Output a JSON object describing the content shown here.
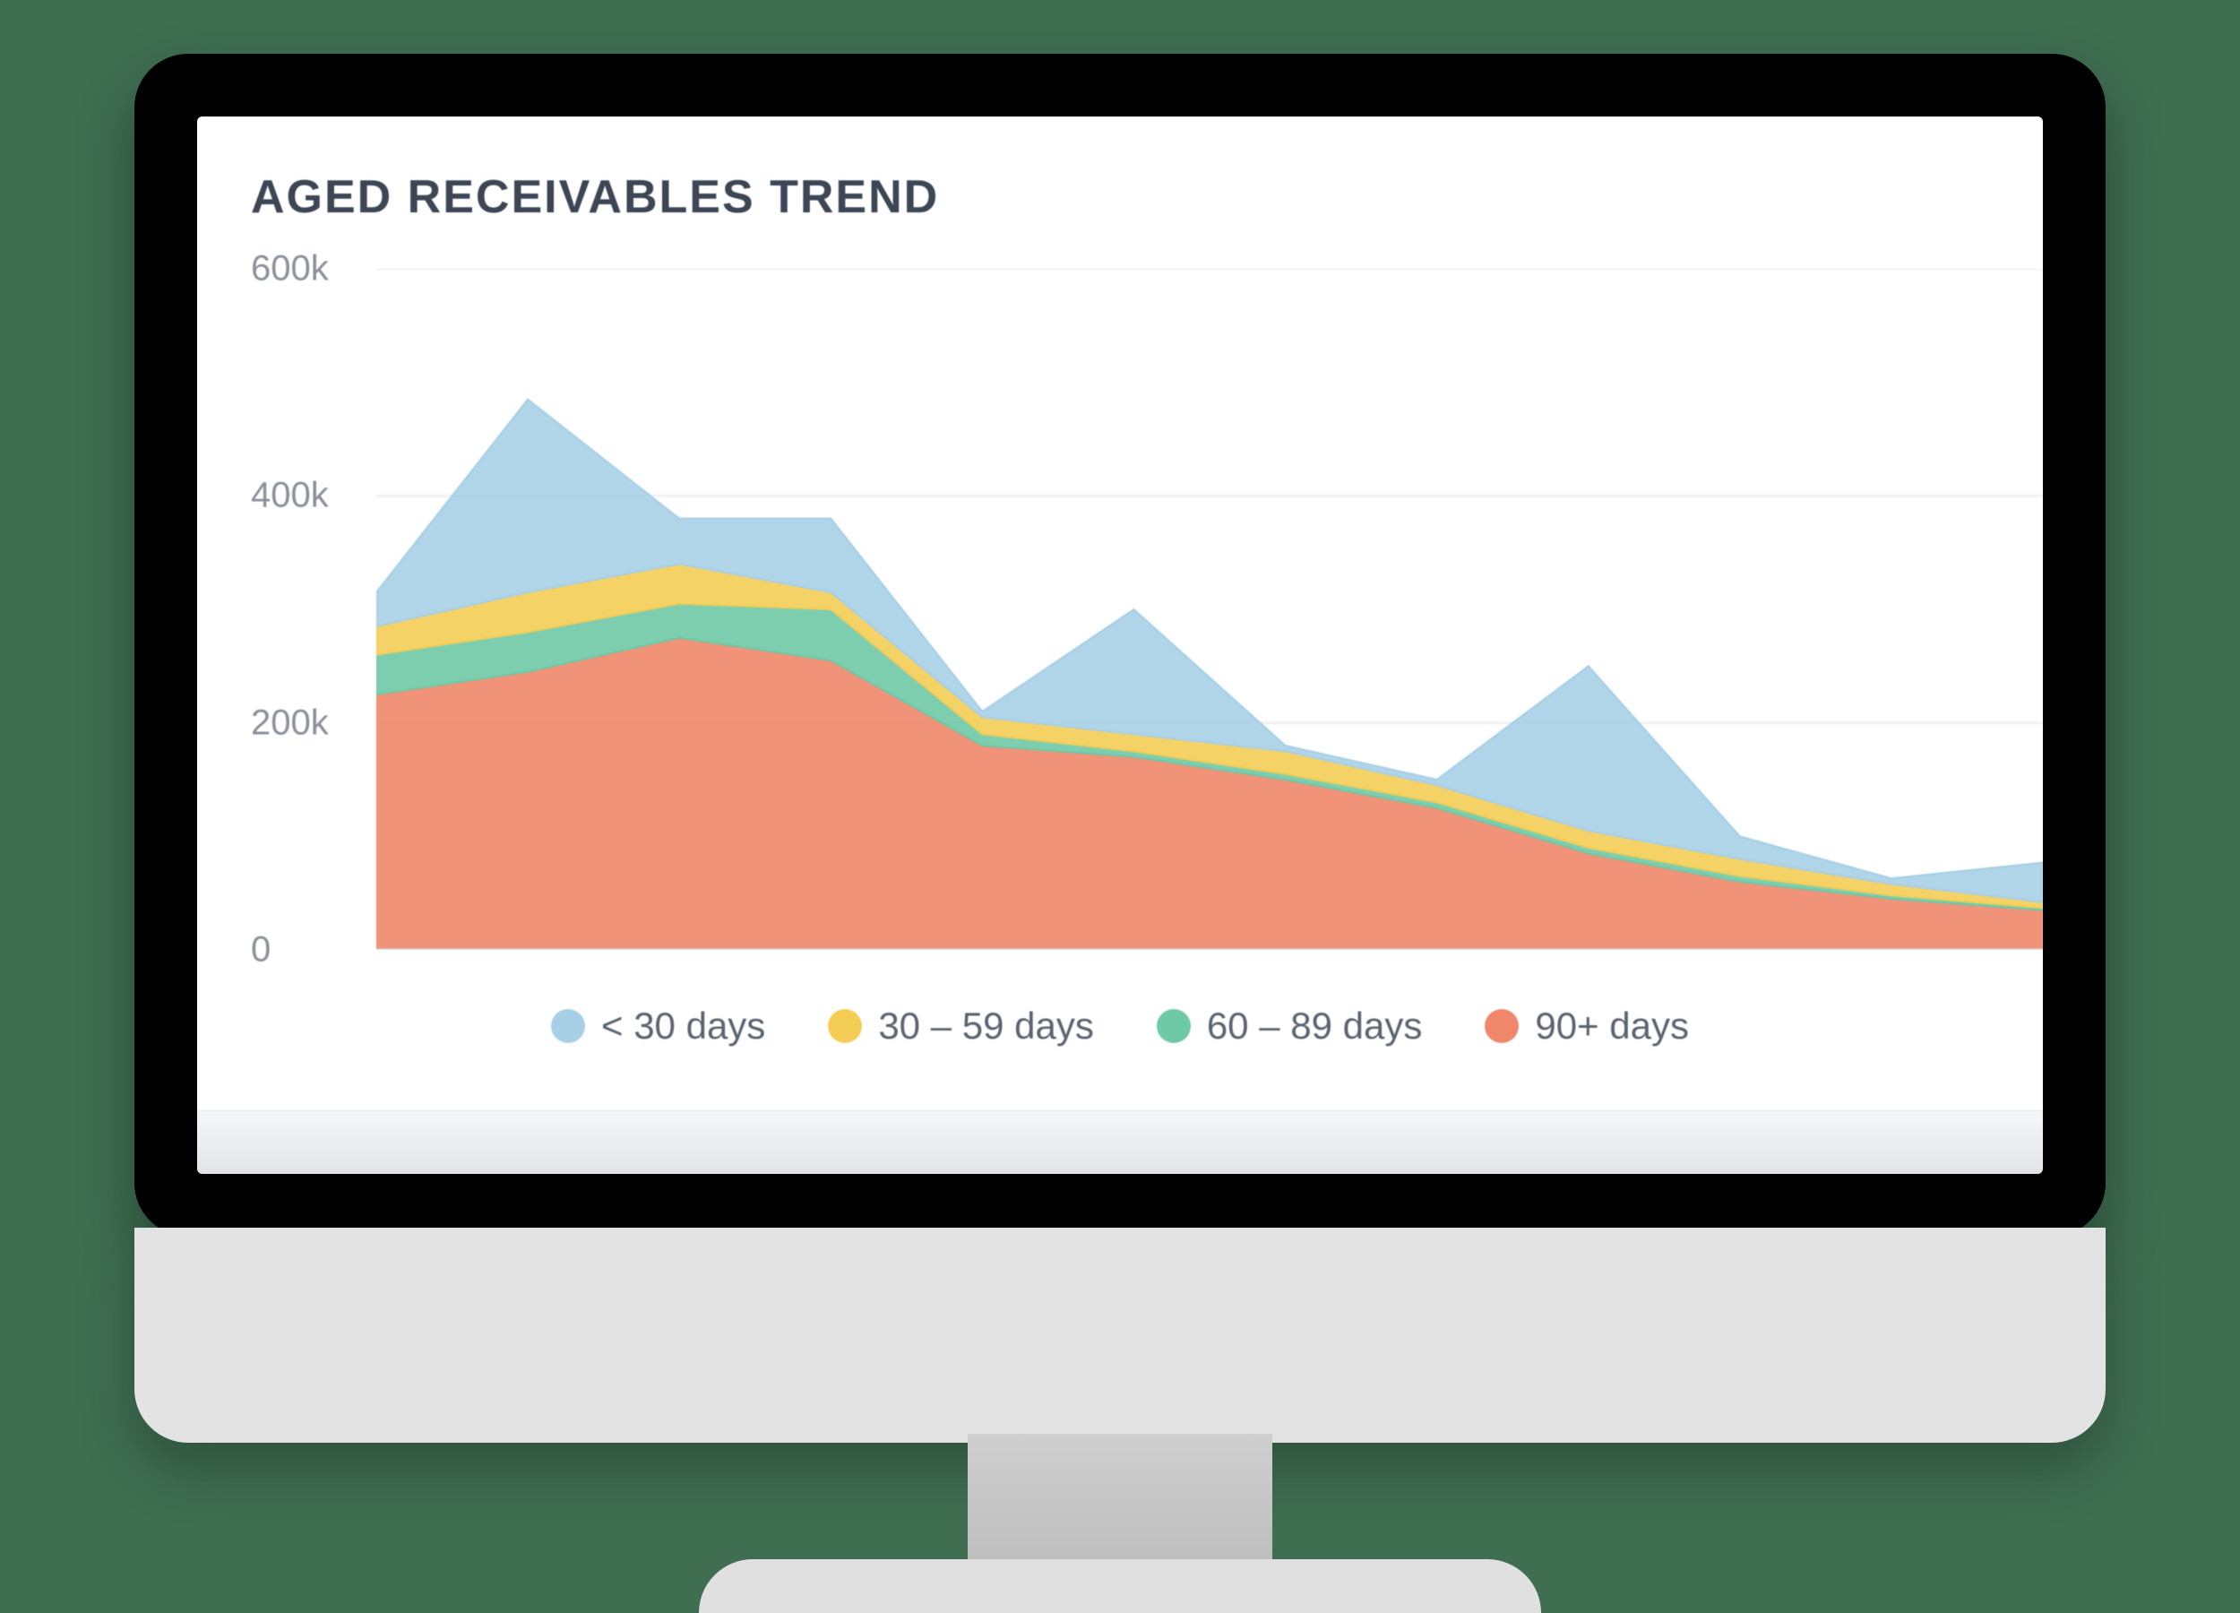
{
  "title": "AGED RECEIVABLES TREND",
  "y_ticks": [
    "0",
    "200k",
    "400k",
    "600k"
  ],
  "legend": [
    {
      "label": "< 30 days",
      "color": "#a7cfe6"
    },
    {
      "label": "30 – 59 days",
      "color": "#f4cd55"
    },
    {
      "label": "60 – 89 days",
      "color": "#6ec9a6"
    },
    {
      "label": "90+ days",
      "color": "#f0876a"
    }
  ],
  "chart_data": {
    "type": "area",
    "title": "AGED RECEIVABLES TREND",
    "xlabel": "",
    "ylabel": "",
    "ylim": [
      0,
      600
    ],
    "y_ticks": [
      0,
      200,
      400,
      600
    ],
    "stacked": true,
    "x": [
      1,
      2,
      3,
      4,
      5,
      6,
      7,
      8,
      9,
      10,
      11,
      12
    ],
    "series": [
      {
        "name": "90+ days",
        "color": "#f0876a",
        "values": [
          225,
          245,
          275,
          255,
          180,
          170,
          150,
          125,
          85,
          60,
          45,
          35
        ]
      },
      {
        "name": "60 – 89 days",
        "color": "#6ec9a6",
        "values": [
          35,
          35,
          30,
          45,
          10,
          5,
          5,
          5,
          5,
          5,
          3,
          2
        ]
      },
      {
        "name": "30 – 59 days",
        "color": "#f4cd55",
        "values": [
          25,
          35,
          35,
          15,
          15,
          15,
          20,
          15,
          15,
          15,
          10,
          5
        ]
      },
      {
        "name": "< 30 days",
        "color": "#a7cfe6",
        "values": [
          30,
          170,
          40,
          65,
          5,
          110,
          5,
          5,
          145,
          20,
          5,
          35
        ]
      }
    ],
    "legend_position": "bottom",
    "grid": true
  }
}
